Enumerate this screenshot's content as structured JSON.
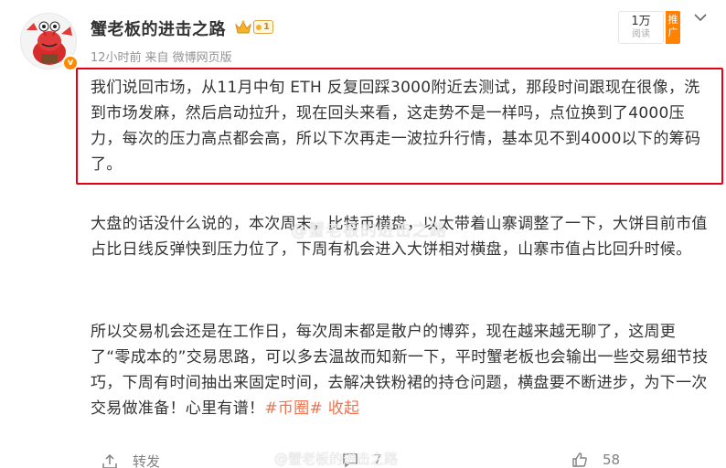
{
  "post": {
    "username": "蟹老板的进击之路",
    "vip_level": "1",
    "time": "12小时前",
    "source_prefix": "来自",
    "source": "微博网页版",
    "read_count": "1万",
    "read_label": "阅读",
    "promote_label": "推广",
    "paragraph1": "我们说回市场，从11月中旬 ETH 反复回踩3000附近去测试，那段时间跟现在很像，洗到市场发麻，然后启动拉升，现在回头来看，这走势不是一样吗，点位换到了4000压力，每次的压力高点都会高，所以下次再走一波拉升行情，基本见不到4000以下的筹码了。",
    "paragraph2": "大盘的话没什么说的，本次周末，比特币横盘，以太带着山寨调整了一下，大饼目前市值占比日线反弹快到压力位了，下周有机会进入大饼相对横盘，山寨市值占比回升时候。",
    "paragraph3_text": "所以交易机会还是在工作日，每次周末都是散户的博弈，现在越来越无聊了，这周更了“零成本的”交易思路，可以多去温故而知新一下，平时蟹老板也会输出一些交易细节技巧，下周有时间抽出来固定时间，去解决铁粉裙的持仓问题，横盘要不断进步，为下一次交易做准备！心里有谱！",
    "topic_tag": "#币圈#",
    "collapse_label": "收起",
    "watermark": "@蟹老板的进击之路"
  },
  "actions": {
    "repost_label": "转发",
    "comment_count": "7",
    "like_count": "58"
  },
  "icons": {
    "avatar_badge": "v-verified-badge",
    "repost": "repost-icon",
    "comment": "comment-icon",
    "like": "thumbs-up-icon",
    "more": "chevron-down-icon",
    "crown": "crown-icon"
  },
  "colors": {
    "highlight_border": "#e60012",
    "link": "#eb7350",
    "promote_bg": "#ff8200",
    "text": "#333333",
    "meta": "#939393"
  }
}
